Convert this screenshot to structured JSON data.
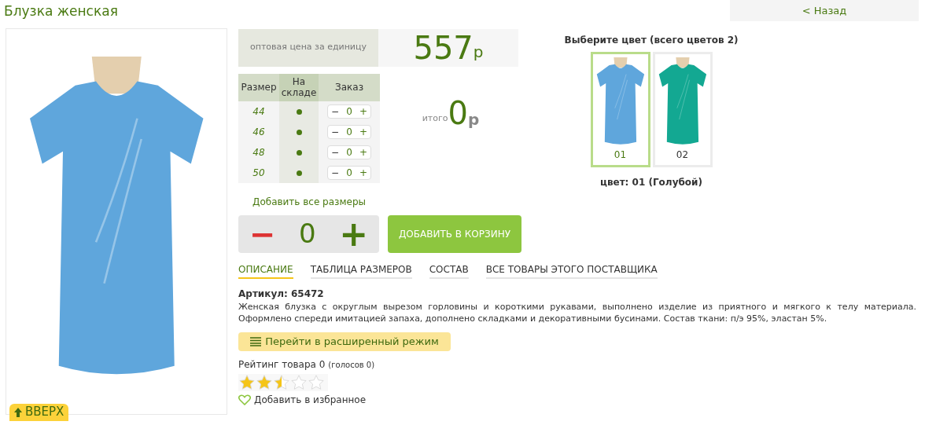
{
  "title": "Блузка женская",
  "back_link": "< Назад",
  "up_button": "ВВЕРХ",
  "price": {
    "label": "оптовая цена за единицу",
    "value": "557",
    "currency": "р"
  },
  "size_table": {
    "columns": [
      "Размер",
      "На складе",
      "Заказ"
    ],
    "rows": [
      {
        "size": "44",
        "in_stock": true,
        "qty": "0",
        "minus": "−",
        "plus": "+"
      },
      {
        "size": "46",
        "in_stock": true,
        "qty": "0",
        "minus": "−",
        "plus": "+"
      },
      {
        "size": "48",
        "in_stock": true,
        "qty": "0",
        "minus": "−",
        "plus": "+"
      },
      {
        "size": "50",
        "in_stock": true,
        "qty": "0",
        "minus": "−",
        "plus": "+"
      }
    ]
  },
  "total": {
    "label": "итого",
    "value": "0",
    "currency": "р"
  },
  "add_all_sizes": "Добавить все размеры",
  "bulk_qty": {
    "minus": "−",
    "value": "0",
    "plus": "+"
  },
  "add_to_cart": "ДОБАВИТЬ В КОРЗИНУ",
  "colors": {
    "title": "Выберите цвет (всего цветов 2)",
    "items": [
      {
        "label": "01",
        "selected": true,
        "color": "#5fa6dc"
      },
      {
        "label": "02",
        "selected": false,
        "color": "#13a892"
      }
    ],
    "current": "цвет: 01 (Голубой)"
  },
  "tabs": [
    {
      "label": "ОПИСАНИЕ",
      "selected": true
    },
    {
      "label": "ТАБЛИЦА РАЗМЕРОВ",
      "selected": false
    },
    {
      "label": "СОСТАВ",
      "selected": false
    },
    {
      "label": "ВСЕ ТОВАРЫ ЭТОГО ПОСТАВЩИКА",
      "selected": false
    }
  ],
  "article": "Артикул: 65472",
  "description": "Женская блузка с округлым вырезом горловины и короткими рукавами, выполнено изделие из приятного и мягкого к телу материала. Оформлено спереди имитацией запаха, дополнено складками и декоративными бусинами. Состав ткани: п/э 95%, эластан 5%.",
  "advanced_mode": "Перейти в расширенный режим",
  "rating": {
    "label": "Рейтинг товара 0",
    "votes": "(голосов 0)",
    "stars": 2.5
  },
  "favorite": "Добавить в избранное"
}
